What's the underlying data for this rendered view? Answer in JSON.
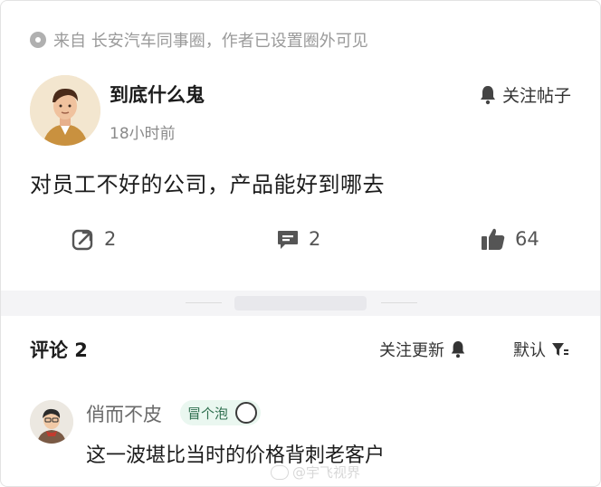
{
  "source": {
    "text": "来自 长安汽车同事圈，作者已设置圈外可见"
  },
  "post": {
    "author": "到底什么鬼",
    "time": "18小时前",
    "follow_label": "关注帖子",
    "content": "对员工不好的公司，产品能好到哪去",
    "actions": {
      "share_count": "2",
      "comment_count": "2",
      "like_count": "64"
    }
  },
  "comments_section": {
    "title": "评论 2",
    "follow_updates_label": "关注更新",
    "sort_label": "默认",
    "items": [
      {
        "author": "俏而不皮",
        "badge": "冒个泡",
        "text": "这一波堪比当时的价格背刺老客户"
      }
    ]
  },
  "watermark": {
    "text": "@宇飞视界"
  },
  "colors": {
    "accent_green": "#2f6f4f",
    "badge_bg": "#eaf7f0",
    "muted": "#9a9a9a"
  }
}
